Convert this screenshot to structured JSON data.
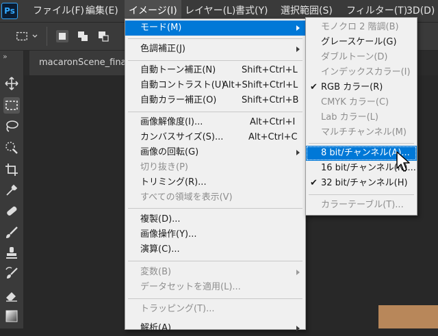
{
  "app": {
    "logo": "Ps"
  },
  "menubar": {
    "items": [
      {
        "label": "ファイル(F)"
      },
      {
        "label": "編集(E)"
      },
      {
        "label": "イメージ(I)"
      },
      {
        "label": "レイヤー(L)"
      },
      {
        "label": "書式(Y)"
      },
      {
        "label": "選択範囲(S)"
      },
      {
        "label": "フィルター(T)"
      },
      {
        "label": "3D(D)"
      }
    ],
    "active_index": 2
  },
  "document_tab": {
    "title": "macaronScene_fina"
  },
  "tools_expand": "»",
  "image_menu": {
    "items": [
      {
        "label": "モード(M)",
        "submenu": true,
        "highlighted": true
      },
      {
        "label": "色調補正(J)",
        "submenu": true
      },
      {
        "label": "自動トーン補正(N)",
        "shortcut": "Shift+Ctrl+L"
      },
      {
        "label": "自動コントラスト(U)",
        "shortcut": "Alt+Shift+Ctrl+L"
      },
      {
        "label": "自動カラー補正(O)",
        "shortcut": "Shift+Ctrl+B"
      },
      {
        "label": "画像解像度(I)...",
        "shortcut": "Alt+Ctrl+I"
      },
      {
        "label": "カンバスサイズ(S)...",
        "shortcut": "Alt+Ctrl+C"
      },
      {
        "label": "画像の回転(G)",
        "submenu": true
      },
      {
        "label": "切り抜き(P)",
        "disabled": true
      },
      {
        "label": "トリミング(R)..."
      },
      {
        "label": "すべての領域を表示(V)",
        "disabled": true
      },
      {
        "label": "複製(D)..."
      },
      {
        "label": "画像操作(Y)..."
      },
      {
        "label": "演算(C)..."
      },
      {
        "label": "変数(B)",
        "submenu": true,
        "disabled": true
      },
      {
        "label": "データセットを適用(L)...",
        "disabled": true
      },
      {
        "label": "トラッピング(T)...",
        "disabled": true
      },
      {
        "label": "解析(A)",
        "submenu": true
      }
    ]
  },
  "mode_submenu": {
    "items": [
      {
        "label": "モノクロ 2 階調(B)",
        "disabled": true
      },
      {
        "label": "グレースケール(G)"
      },
      {
        "label": "ダブルトーン(D)",
        "disabled": true
      },
      {
        "label": "インデックスカラー(I)",
        "disabled": true
      },
      {
        "label": "RGB カラー(R)",
        "checked": true
      },
      {
        "label": "CMYK カラー(C)",
        "disabled": true
      },
      {
        "label": "Lab カラー(L)",
        "disabled": true
      },
      {
        "label": "マルチチャンネル(M)",
        "disabled": true
      },
      {
        "label": "8 bit/チャンネル(A)...",
        "highlighted": true
      },
      {
        "label": "16 bit/チャンネル(N)..."
      },
      {
        "label": "32 bit/チャンネル(H)",
        "checked": true
      },
      {
        "label": "カラーテーブル(T)...",
        "disabled": true
      }
    ]
  },
  "check_glyph": "✔",
  "colors": {
    "menu_highlight": "#0078d7",
    "menubar_bg": "#3a3a3a",
    "menu_bg": "#f0f0f0"
  }
}
